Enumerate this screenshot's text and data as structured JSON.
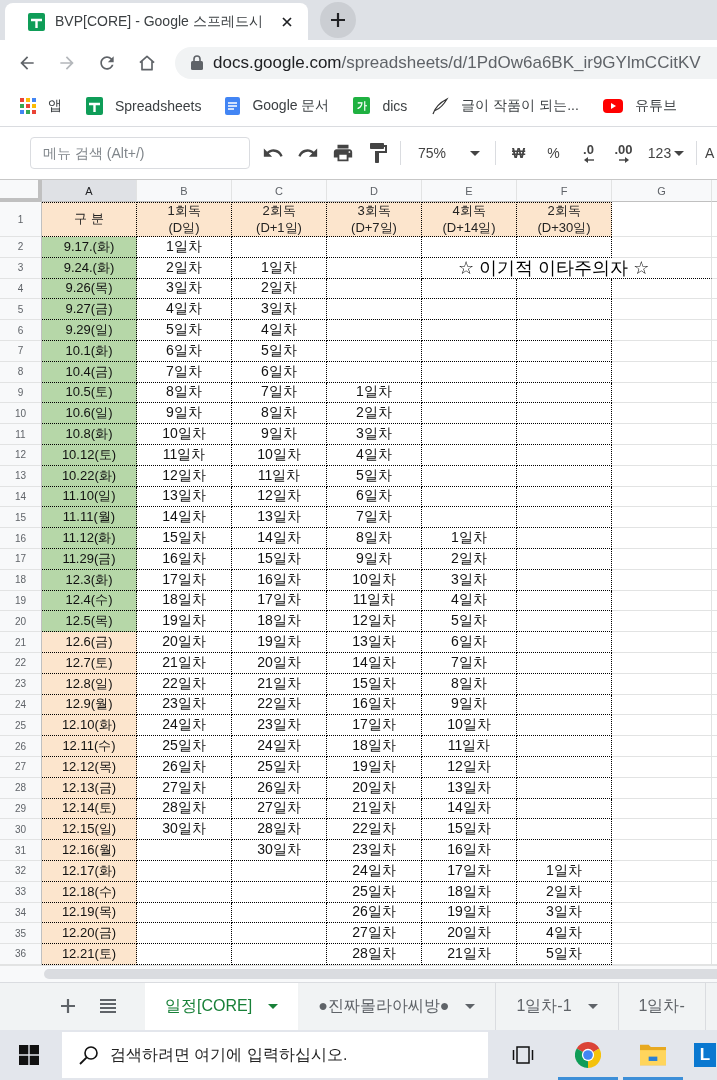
{
  "browser": {
    "tab_title": "BVP[CORE] - Google 스프레드시",
    "nav_buttons": [
      {
        "kind": "back",
        "disabled": false
      },
      {
        "kind": "forward",
        "disabled": true
      },
      {
        "kind": "reload",
        "disabled": false
      },
      {
        "kind": "home",
        "disabled": false
      }
    ],
    "address": {
      "host": "docs.google.com",
      "path": "/spreadsheets/d/1PdOw6a6BK_ir9GYlmCCitKV"
    }
  },
  "bookmarks": [
    {
      "kind": "apps",
      "label": "앱"
    },
    {
      "kind": "sheets",
      "label": "Spreadsheets"
    },
    {
      "kind": "docs",
      "label": "Google 문서"
    },
    {
      "kind": "tile",
      "badge": "가",
      "label": "dics"
    },
    {
      "kind": "pen",
      "label": "글이 작품이 되는..."
    },
    {
      "kind": "youtube",
      "label": "유튜브"
    }
  ],
  "toolbar": {
    "search": {
      "placeholder": "메뉴 검색 (Alt+/)"
    },
    "zoom": "75%",
    "currency": "₩",
    "percent": "%",
    "decimal_decrease": ".0",
    "decimal_increase": ".00",
    "number_format": "123",
    "font_menu": "A"
  },
  "sheet": {
    "columns": [
      {
        "label": "A",
        "selected": true
      },
      {
        "label": "B",
        "selected": false
      },
      {
        "label": "C",
        "selected": false
      },
      {
        "label": "D",
        "selected": false
      },
      {
        "label": "E",
        "selected": false
      },
      {
        "label": "F",
        "selected": false
      },
      {
        "label": "G",
        "selected": false
      }
    ],
    "rows": [
      {
        "number": "1",
        "kind": "header",
        "color": "#fce5cd",
        "a": "구 분",
        "b": "1회독\n(D일)",
        "c": "2회독\n(D+1일)",
        "d": "3회독\n(D+7일)",
        "e": "4회독\n(D+14일)",
        "f": "2회독\n(D+30일)"
      },
      {
        "number": "2",
        "kind": "data",
        "color": "#b6d7a8",
        "a": "9.17.(화)",
        "b": "1일차"
      },
      {
        "number": "3",
        "kind": "data",
        "color": "#b6d7a8",
        "a": "9.24.(화)",
        "b": "2일차",
        "c": "1일차",
        "note": "☆ 이기적 이타주의자 ☆"
      },
      {
        "number": "4",
        "kind": "data",
        "color": "#b6d7a8",
        "a": "9.26(목)",
        "b": "3일차",
        "c": "2일차"
      },
      {
        "number": "5",
        "kind": "data",
        "color": "#b6d7a8",
        "a": "9.27(금)",
        "b": "4일차",
        "c": "3일차"
      },
      {
        "number": "6",
        "kind": "data",
        "color": "#b6d7a8",
        "a": "9.29(일)",
        "b": "5일차",
        "c": "4일차"
      },
      {
        "number": "7",
        "kind": "data",
        "color": "#b6d7a8",
        "a": "10.1(화)",
        "b": "6일차",
        "c": "5일차"
      },
      {
        "number": "8",
        "kind": "data",
        "color": "#b6d7a8",
        "a": "10.4(금)",
        "b": "7일차",
        "c": "6일차"
      },
      {
        "number": "9",
        "kind": "data",
        "color": "#b6d7a8",
        "a": "10.5(토)",
        "b": "8일차",
        "c": "7일차",
        "d": "1일차"
      },
      {
        "number": "10",
        "kind": "data",
        "color": "#b6d7a8",
        "a": "10.6(일)",
        "b": "9일차",
        "c": "8일차",
        "d": "2일차"
      },
      {
        "number": "11",
        "kind": "data",
        "color": "#b6d7a8",
        "a": "10.8(화)",
        "b": "10일차",
        "c": "9일차",
        "d": "3일차"
      },
      {
        "number": "12",
        "kind": "data",
        "color": "#b6d7a8",
        "a": "10.12(토)",
        "b": "11일차",
        "c": "10일차",
        "d": "4일차"
      },
      {
        "number": "13",
        "kind": "data",
        "color": "#b6d7a8",
        "a": "10.22(화)",
        "b": "12일차",
        "c": "11일차",
        "d": "5일차"
      },
      {
        "number": "14",
        "kind": "data",
        "color": "#b6d7a8",
        "a": "11.10(일)",
        "b": "13일차",
        "c": "12일차",
        "d": "6일차"
      },
      {
        "number": "15",
        "kind": "data",
        "color": "#b6d7a8",
        "a": "11.11(월)",
        "b": "14일차",
        "c": "13일차",
        "d": "7일차"
      },
      {
        "number": "16",
        "kind": "data",
        "color": "#b6d7a8",
        "a": "11.12(화)",
        "b": "15일차",
        "c": "14일차",
        "d": "8일차",
        "e": "1일차"
      },
      {
        "number": "17",
        "kind": "data",
        "color": "#b6d7a8",
        "a": "11.29(금)",
        "b": "16일차",
        "c": "15일차",
        "d": "9일차",
        "e": "2일차"
      },
      {
        "number": "18",
        "kind": "data",
        "color": "#b6d7a8",
        "a": "12.3(화)",
        "b": "17일차",
        "c": "16일차",
        "d": "10일차",
        "e": "3일차"
      },
      {
        "number": "19",
        "kind": "data",
        "color": "#b6d7a8",
        "a": "12.4(수)",
        "b": "18일차",
        "c": "17일차",
        "d": "11일차",
        "e": "4일차"
      },
      {
        "number": "20",
        "kind": "data",
        "color": "#b6d7a8",
        "a": "12.5(목)",
        "b": "19일차",
        "c": "18일차",
        "d": "12일차",
        "e": "5일차"
      },
      {
        "number": "21",
        "kind": "data",
        "color": "#fce5cd",
        "a": "12.6(금)",
        "b": "20일차",
        "c": "19일차",
        "d": "13일차",
        "e": "6일차"
      },
      {
        "number": "22",
        "kind": "data",
        "color": "#fce5cd",
        "a": "12.7(토)",
        "b": "21일차",
        "c": "20일차",
        "d": "14일차",
        "e": "7일차"
      },
      {
        "number": "23",
        "kind": "data",
        "color": "#fce5cd",
        "a": "12.8(일)",
        "b": "22일차",
        "c": "21일차",
        "d": "15일차",
        "e": "8일차"
      },
      {
        "number": "24",
        "kind": "data",
        "color": "#fce5cd",
        "a": "12.9(월)",
        "b": "23일차",
        "c": "22일차",
        "d": "16일차",
        "e": "9일차"
      },
      {
        "number": "25",
        "kind": "data",
        "color": "#fce5cd",
        "a": "12.10(화)",
        "b": "24일차",
        "c": "23일차",
        "d": "17일차",
        "e": "10일차"
      },
      {
        "number": "26",
        "kind": "data",
        "color": "#fce5cd",
        "a": "12.11(수)",
        "b": "25일차",
        "c": "24일차",
        "d": "18일차",
        "e": "11일차"
      },
      {
        "number": "27",
        "kind": "data",
        "color": "#fce5cd",
        "a": "12.12(목)",
        "b": "26일차",
        "c": "25일차",
        "d": "19일차",
        "e": "12일차"
      },
      {
        "number": "28",
        "kind": "data",
        "color": "#fce5cd",
        "a": "12.13(금)",
        "b": "27일차",
        "c": "26일차",
        "d": "20일차",
        "e": "13일차"
      },
      {
        "number": "29",
        "kind": "data",
        "color": "#fce5cd",
        "a": "12.14(토)",
        "b": "28일차",
        "c": "27일차",
        "d": "21일차",
        "e": "14일차"
      },
      {
        "number": "30",
        "kind": "data",
        "color": "#fce5cd",
        "a": "12.15(일)",
        "b": "30일차",
        "c": "28일차",
        "d": "22일차",
        "e": "15일차"
      },
      {
        "number": "31",
        "kind": "data",
        "color": "#fce5cd",
        "a": "12.16(월)",
        "c": "30일차",
        "d": "23일차",
        "e": "16일차"
      },
      {
        "number": "32",
        "kind": "data",
        "color": "#fce5cd",
        "a": "12.17(화)",
        "d": "24일차",
        "e": "17일차",
        "f": "1일차"
      },
      {
        "number": "33",
        "kind": "data",
        "color": "#fce5cd",
        "a": "12.18(수)",
        "d": "25일차",
        "e": "18일차",
        "f": "2일차"
      },
      {
        "number": "34",
        "kind": "data",
        "color": "#fce5cd",
        "a": "12.19(목)",
        "d": "26일차",
        "e": "19일차",
        "f": "3일차"
      },
      {
        "number": "35",
        "kind": "data",
        "color": "#fce5cd",
        "a": "12.20(금)",
        "d": "27일차",
        "e": "20일차",
        "f": "4일차"
      },
      {
        "number": "36",
        "kind": "data",
        "color": "#fce5cd",
        "a": "12.21(토)",
        "d": "28일차",
        "e": "21일차",
        "f": "5일차"
      }
    ]
  },
  "sheet_tabs": [
    {
      "label": "일정[CORE]",
      "selected": true,
      "caret": true
    },
    {
      "label": "●진짜몰라아씨방●",
      "selected": false,
      "caret": true
    },
    {
      "label": "1일차-1",
      "selected": false,
      "caret": true
    },
    {
      "label": "1일차-",
      "selected": false,
      "caret": false
    }
  ],
  "taskbar": {
    "search": {
      "placeholder": "검색하려면 여기에 입력하십시오."
    },
    "apps": [
      {
        "kind": "task_view",
        "running": false
      },
      {
        "kind": "browser",
        "running": true
      },
      {
        "kind": "folder",
        "running": true
      },
      {
        "kind": "tile",
        "label": "L",
        "running": false
      }
    ]
  }
}
